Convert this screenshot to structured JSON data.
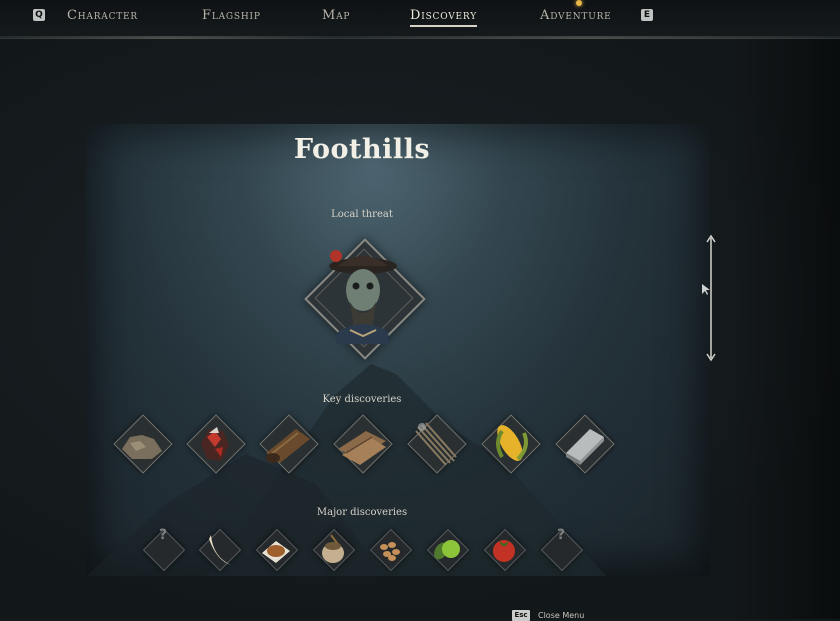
{
  "nav": {
    "left_key": "Q",
    "right_key": "E",
    "tabs": [
      {
        "label": "Character",
        "active": false
      },
      {
        "label": "Flagship",
        "active": false
      },
      {
        "label": "Map",
        "active": false
      },
      {
        "label": "Discovery",
        "active": true
      },
      {
        "label": "Adventure",
        "active": false
      }
    ],
    "notification_color": "#e8b74a"
  },
  "region": {
    "title": "Foothills",
    "local_threat_label": "Local threat",
    "local_threat_icon": "pirate-captain-icon",
    "key_discoveries_label": "Key discoveries",
    "key_discoveries": [
      {
        "icon": "stone-ore-icon"
      },
      {
        "icon": "red-crystal-ore-icon"
      },
      {
        "icon": "wood-log-icon"
      },
      {
        "icon": "wood-planks-icon"
      },
      {
        "icon": "fiber-bundle-icon"
      },
      {
        "icon": "corn-icon"
      },
      {
        "icon": "metal-ingot-icon"
      }
    ],
    "major_discoveries_label": "Major discoveries",
    "major_discoveries": [
      {
        "icon": "unknown-icon",
        "label": "?"
      },
      {
        "icon": "tusk-icon"
      },
      {
        "icon": "cooked-meat-icon"
      },
      {
        "icon": "grain-sack-icon"
      },
      {
        "icon": "nuts-icon"
      },
      {
        "icon": "green-fruit-icon"
      },
      {
        "icon": "tomato-icon"
      },
      {
        "icon": "unknown-icon",
        "label": "?"
      }
    ]
  },
  "footer": {
    "esc_key": "Esc",
    "close_label": "Close Menu"
  }
}
